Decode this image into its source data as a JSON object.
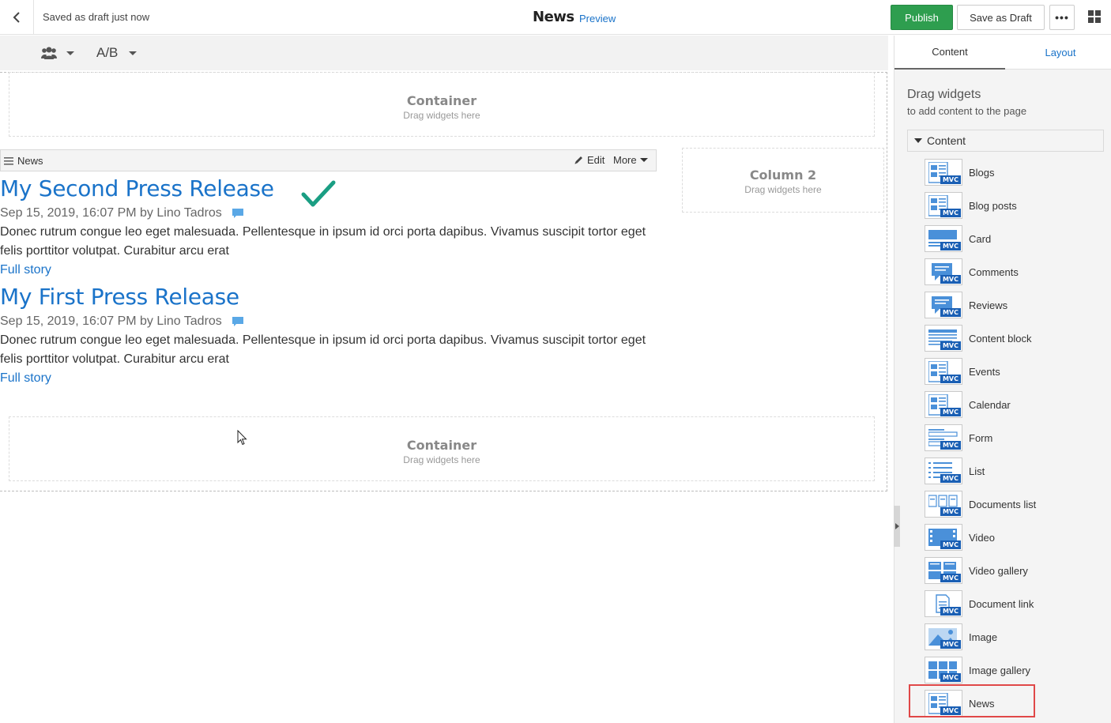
{
  "header": {
    "draft_status": "Saved as draft just now",
    "page_title": "News",
    "preview_label": "Preview",
    "publish_label": "Publish",
    "save_draft_label": "Save as Draft",
    "more_label": "•••",
    "colors": {
      "publish": "#2e9e4f",
      "link": "#1a73c9"
    }
  },
  "toolbar": {
    "ab_label": "A/B"
  },
  "canvas": {
    "top_container": {
      "title": "Container",
      "hint": "Drag widgets here"
    },
    "column2": {
      "title": "Column 2",
      "hint": "Drag widgets here"
    },
    "bottom_container": {
      "title": "Container",
      "hint": "Drag widgets here"
    },
    "news_widget": {
      "label": "News",
      "edit_label": "Edit",
      "more_label": "More"
    },
    "articles": [
      {
        "title": "My Second Press Release",
        "meta": "Sep 15, 2019, 16:07 PM by Lino Tadros",
        "body": "Donec rutrum congue leo eget malesuada. Pellentesque in ipsum id orci porta dapibus. Vivamus suscipit tortor eget felis porttitor volutpat. Curabitur arcu erat",
        "link": "Full story"
      },
      {
        "title": "My First Press Release",
        "meta": "Sep 15, 2019, 16:07 PM by Lino Tadros",
        "body": "Donec rutrum congue leo eget malesuada. Pellentesque in ipsum id orci porta dapibus. Vivamus suscipit tortor eget felis porttitor volutpat. Curabitur arcu erat",
        "link": "Full story"
      }
    ]
  },
  "panel": {
    "tabs": [
      {
        "label": "Content"
      },
      {
        "label": "Layout"
      }
    ],
    "heading": "Drag widgets",
    "subheading": "to add content to the page",
    "group_label": "Content",
    "mvc_badge": "MVC",
    "widgets": [
      {
        "label": "Blogs",
        "icon": "list-doc-icon"
      },
      {
        "label": "Blog posts",
        "icon": "list-doc-icon"
      },
      {
        "label": "Card",
        "icon": "card-icon"
      },
      {
        "label": "Comments",
        "icon": "comment-icon"
      },
      {
        "label": "Reviews",
        "icon": "comment-icon"
      },
      {
        "label": "Content block",
        "icon": "content-block-icon"
      },
      {
        "label": "Events",
        "icon": "list-doc-icon"
      },
      {
        "label": "Calendar",
        "icon": "list-doc-icon"
      },
      {
        "label": "Form",
        "icon": "form-icon"
      },
      {
        "label": "List",
        "icon": "list-icon"
      },
      {
        "label": "Documents list",
        "icon": "documents-icon"
      },
      {
        "label": "Video",
        "icon": "video-icon"
      },
      {
        "label": "Video gallery",
        "icon": "video-gallery-icon"
      },
      {
        "label": "Document link",
        "icon": "document-link-icon"
      },
      {
        "label": "Image",
        "icon": "image-icon"
      },
      {
        "label": "Image gallery",
        "icon": "image-gallery-icon"
      },
      {
        "label": "News",
        "icon": "list-doc-icon"
      }
    ]
  }
}
